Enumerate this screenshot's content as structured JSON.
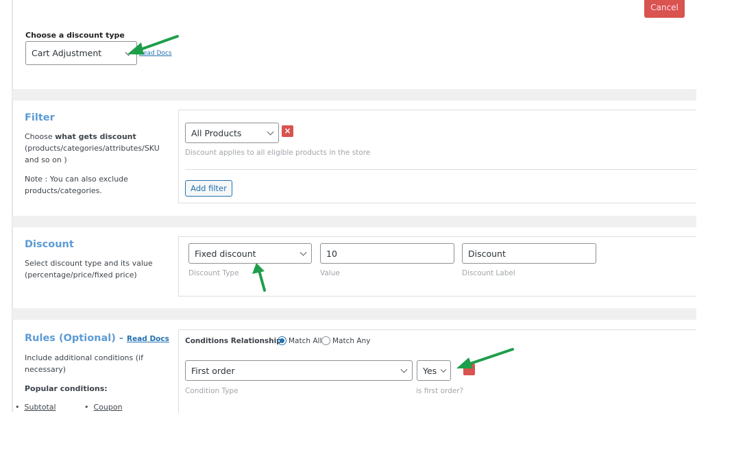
{
  "header": {
    "cancel_label": "Cancel",
    "discount_type_label": "Choose a discount type",
    "discount_type_value": "Cart Adjustment",
    "read_docs": "Read Docs"
  },
  "filter": {
    "title": "Filter",
    "desc_prefix": "Choose ",
    "desc_bold": "what gets discount",
    "desc_rest": " (products/categories/attributes/SKU and so on )",
    "note": "Note : You can also exclude products/categories.",
    "select_value": "All Products",
    "remove_icon": "×",
    "hint": "Discount applies to all eligible products in the store",
    "add_filter": "Add filter"
  },
  "discount": {
    "title": "Discount",
    "desc": "Select discount type and its value (percentage/price/fixed price)",
    "type_value": "Fixed discount",
    "type_hint": "Discount Type",
    "value": "10",
    "value_hint": "Value",
    "label_value": "Discount",
    "label_hint": "Discount Label"
  },
  "rules": {
    "title": "Rules (Optional) - ",
    "read_docs": "Read Docs",
    "desc": "Include additional conditions (if necessary)",
    "popular": "Popular conditions:",
    "popular_items": [
      "Subtotal",
      "Coupon"
    ],
    "relationship_label": "Conditions Relationship",
    "match_all": "Match All",
    "match_any": "Match Any",
    "selected": "Match All",
    "condition_type": "First order",
    "condition_type_hint": "Condition Type",
    "condition_value": "Yes",
    "condition_value_hint": "is first order?"
  },
  "colors": {
    "accent": "#5b9bd5",
    "danger": "#d9534f",
    "arrow": "#1e9e4a"
  }
}
